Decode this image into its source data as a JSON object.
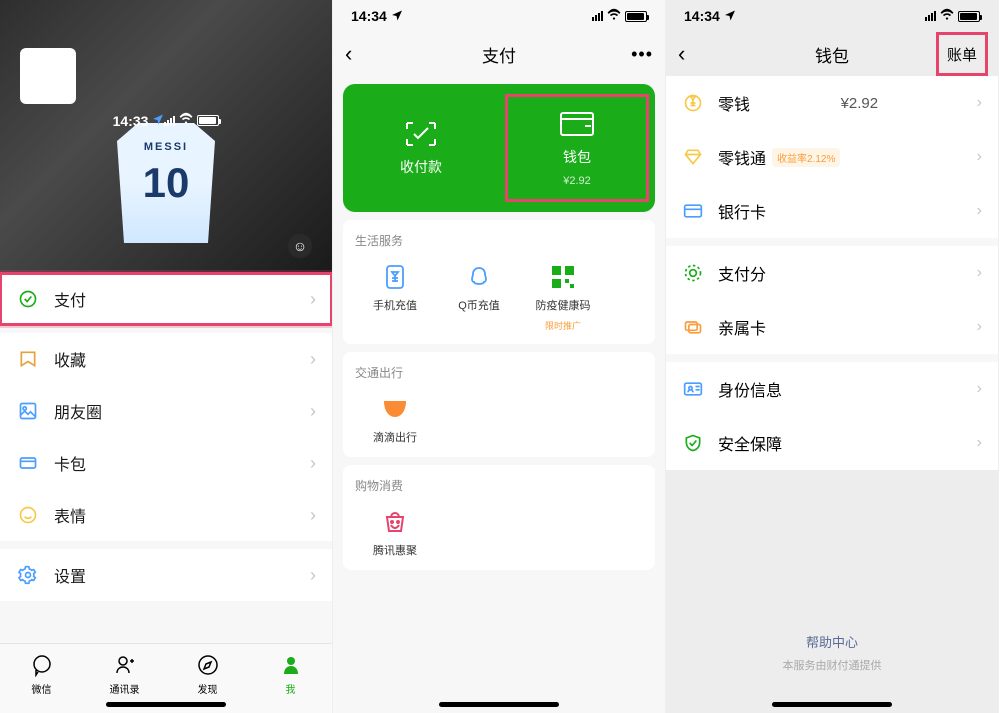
{
  "status": {
    "time": "14:33",
    "time2": "14:34",
    "time3": "14:34"
  },
  "screen1": {
    "jersey_number": "10",
    "jersey_name": "MESSI",
    "menu": [
      {
        "label": "支付"
      },
      {
        "label": "收藏"
      },
      {
        "label": "朋友圈"
      },
      {
        "label": "卡包"
      },
      {
        "label": "表情"
      },
      {
        "label": "设置"
      }
    ],
    "tabs": [
      {
        "label": "微信"
      },
      {
        "label": "通讯录"
      },
      {
        "label": "发现"
      },
      {
        "label": "我"
      }
    ]
  },
  "screen2": {
    "title": "支付",
    "receive_pay": "收付款",
    "wallet": "钱包",
    "wallet_balance": "¥2.92",
    "sections": {
      "life": {
        "title": "生活服务",
        "items": [
          {
            "label": "手机充值"
          },
          {
            "label": "Q币充值"
          },
          {
            "label": "防疫健康码",
            "sub": "限时推广"
          }
        ]
      },
      "transport": {
        "title": "交通出行",
        "items": [
          {
            "label": "滴滴出行"
          }
        ]
      },
      "shopping": {
        "title": "购物消费",
        "items": [
          {
            "label": "腾讯惠聚"
          }
        ]
      }
    }
  },
  "screen3": {
    "title": "钱包",
    "nav_right": "账单",
    "items": [
      {
        "label": "零钱",
        "value": "¥2.92"
      },
      {
        "label": "零钱通",
        "tag": "收益率2.12%"
      },
      {
        "label": "银行卡"
      },
      {
        "label": "支付分"
      },
      {
        "label": "亲属卡"
      },
      {
        "label": "身份信息"
      },
      {
        "label": "安全保障"
      }
    ],
    "footer": {
      "help": "帮助中心",
      "provider": "本服务由财付通提供"
    }
  }
}
